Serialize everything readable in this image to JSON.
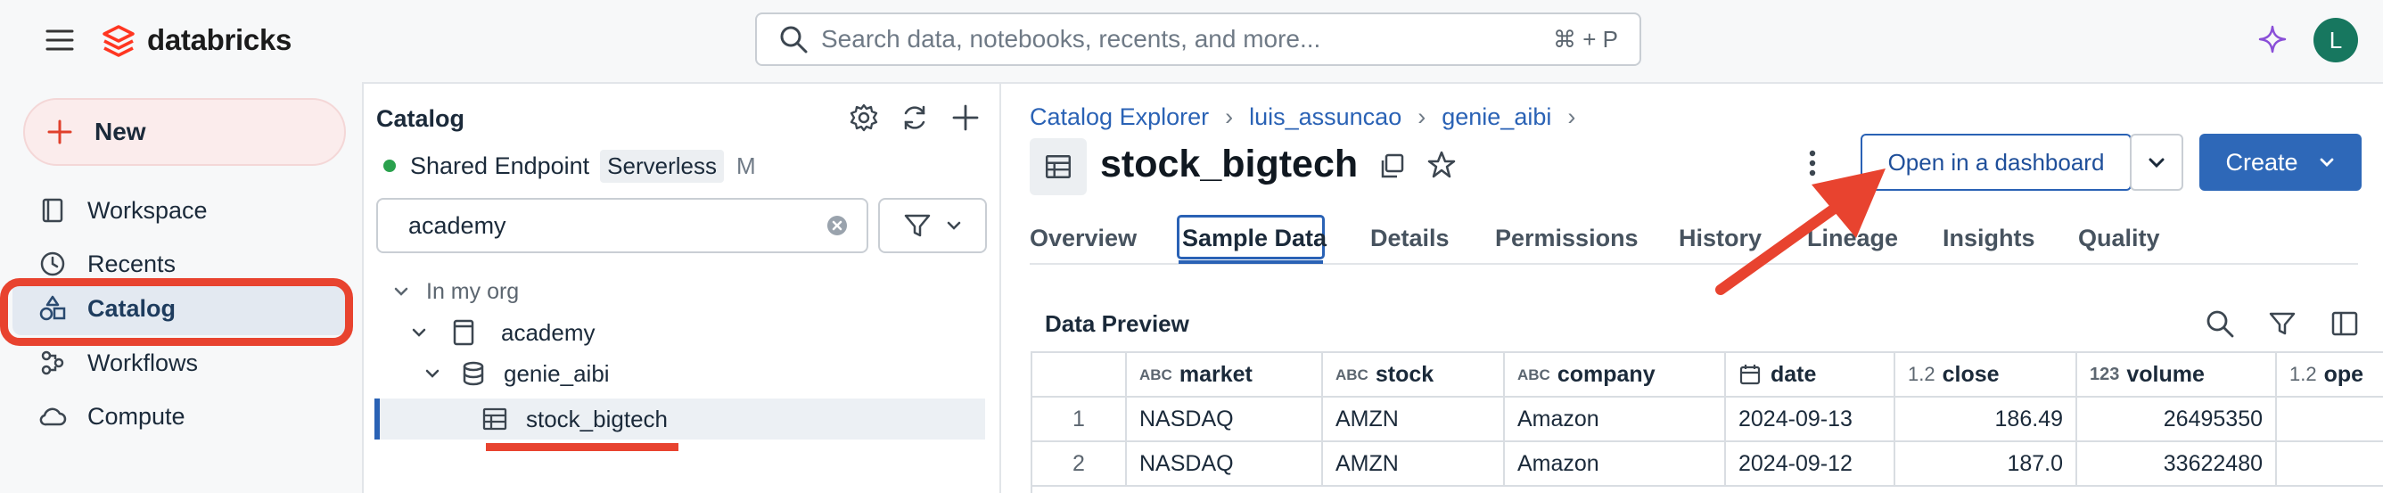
{
  "colors": {
    "accent": "#2a62b5",
    "brand": "#ff3621",
    "annotation": "#e8432f",
    "avatar": "#17775f"
  },
  "topbar": {
    "brand": "databricks",
    "search_placeholder": "Search data, notebooks, recents, and more...",
    "search_shortcut": "⌘ + P",
    "avatar_initial": "L"
  },
  "leftnav": {
    "new_label": "New",
    "items": [
      {
        "label": "Workspace",
        "icon": "workspace-icon"
      },
      {
        "label": "Recents",
        "icon": "clock-icon"
      },
      {
        "label": "Catalog",
        "icon": "catalog-icon"
      },
      {
        "label": "Workflows",
        "icon": "workflows-icon"
      },
      {
        "label": "Compute",
        "icon": "cloud-icon"
      }
    ]
  },
  "catalog_panel": {
    "title": "Catalog",
    "endpoint_name": "Shared Endpoint",
    "endpoint_type": "Serverless",
    "endpoint_size": "M",
    "filter_value": "academy",
    "tree_root": "In my org",
    "tree_catalog": "academy",
    "tree_schema": "genie_aibi",
    "tree_table": "stock_bigtech"
  },
  "main": {
    "breadcrumb": [
      "Catalog Explorer",
      "luis_assuncao",
      "genie_aibi"
    ],
    "title": "stock_bigtech",
    "open_dashboard_label": "Open in a dashboard",
    "create_label": "Create",
    "tabs": [
      "Overview",
      "Sample Data",
      "Details",
      "Permissions",
      "History",
      "Lineage",
      "Insights",
      "Quality"
    ],
    "active_tab": "Sample Data",
    "preview_title": "Data Preview"
  },
  "table": {
    "columns": [
      {
        "name": "market",
        "type_icon": "ABC"
      },
      {
        "name": "stock",
        "type_icon": "ABC"
      },
      {
        "name": "company",
        "type_icon": "ABC"
      },
      {
        "name": "date",
        "type_icon": "calendar"
      },
      {
        "name": "close",
        "type_icon": "1.2"
      },
      {
        "name": "volume",
        "type_icon": "123"
      },
      {
        "name": "ope",
        "type_icon": "1.2"
      }
    ],
    "rows": [
      {
        "n": "1",
        "market": "NASDAQ",
        "stock": "AMZN",
        "company": "Amazon",
        "date": "2024-09-13",
        "close": "186.49",
        "volume": "26495350"
      },
      {
        "n": "2",
        "market": "NASDAQ",
        "stock": "AMZN",
        "company": "Amazon",
        "date": "2024-09-12",
        "close": "187.0",
        "volume": "33622480"
      }
    ]
  }
}
